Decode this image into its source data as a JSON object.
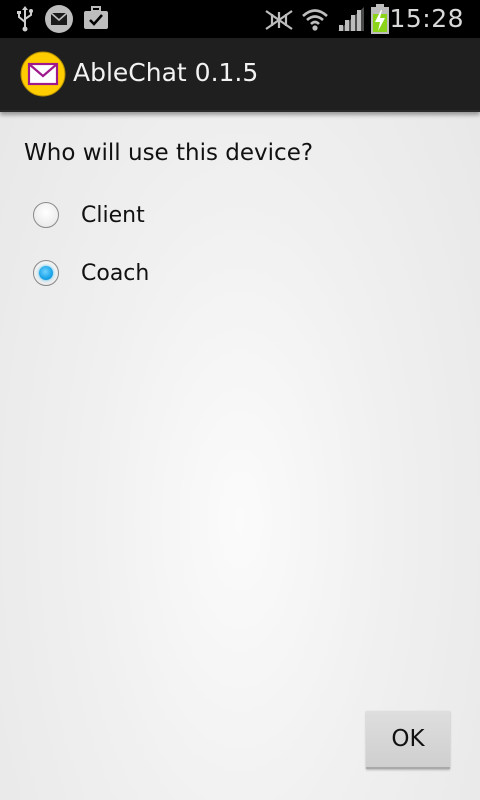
{
  "status_bar": {
    "time": "15:28",
    "icons": [
      "usb-icon",
      "email-notification-icon",
      "briefcase-check-icon",
      "mute-icon",
      "wifi-icon",
      "signal-icon",
      "battery-charging-icon"
    ]
  },
  "action_bar": {
    "app_icon": "envelope-icon",
    "title": "AbleChat 0.1.5"
  },
  "content": {
    "question": "Who will use this device?",
    "options": [
      {
        "label": "Client",
        "checked": false
      },
      {
        "label": "Coach",
        "checked": true
      }
    ]
  },
  "footer": {
    "ok_label": "OK"
  },
  "colors": {
    "accent": "#33b5e5",
    "app_icon_bg": "#ffcc00",
    "envelope": "#a0198c"
  }
}
